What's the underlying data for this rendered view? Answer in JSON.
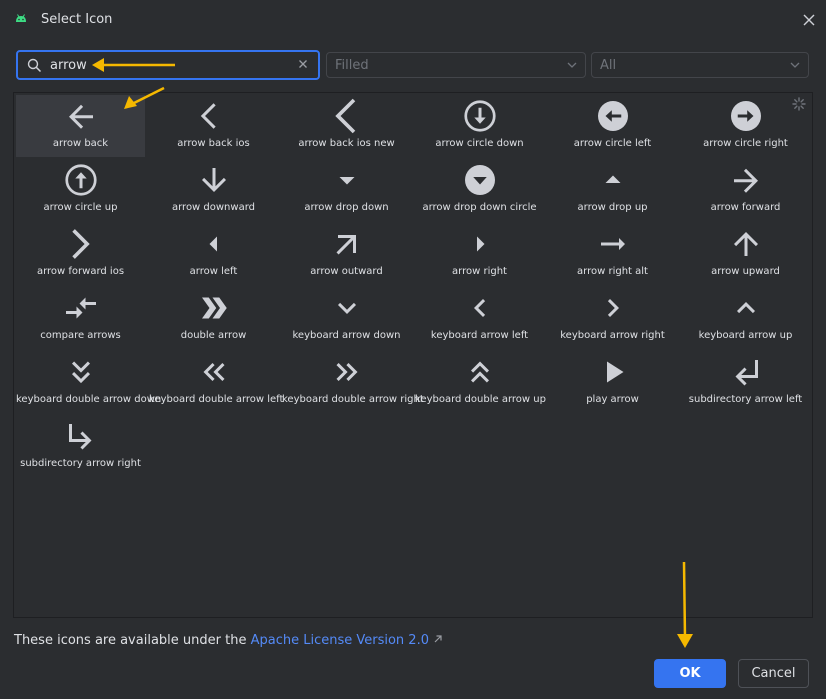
{
  "dialog": {
    "title": "Select Icon",
    "app_icon": "android-icon",
    "close_icon": "close-icon"
  },
  "search": {
    "value": "arrow",
    "search_icon": "search-icon",
    "clear_icon": "clear-icon"
  },
  "filters": {
    "style": "Filled",
    "category": "All"
  },
  "icons": [
    {
      "label": "arrow back",
      "icon": "arrow-back",
      "selected": true
    },
    {
      "label": "arrow back ios",
      "icon": "arrow-back-ios"
    },
    {
      "label": "arrow back ios new",
      "icon": "arrow-back-ios-new"
    },
    {
      "label": "arrow circle down",
      "icon": "arrow-circle-down"
    },
    {
      "label": "arrow circle left",
      "icon": "arrow-circle-left"
    },
    {
      "label": "arrow circle right",
      "icon": "arrow-circle-right"
    },
    {
      "label": "arrow circle up",
      "icon": "arrow-circle-up"
    },
    {
      "label": "arrow downward",
      "icon": "arrow-downward"
    },
    {
      "label": "arrow drop down",
      "icon": "arrow-drop-down"
    },
    {
      "label": "arrow drop down circle",
      "icon": "arrow-drop-down-circle"
    },
    {
      "label": "arrow drop up",
      "icon": "arrow-drop-up"
    },
    {
      "label": "arrow forward",
      "icon": "arrow-forward"
    },
    {
      "label": "arrow forward ios",
      "icon": "arrow-forward-ios"
    },
    {
      "label": "arrow left",
      "icon": "arrow-left"
    },
    {
      "label": "arrow outward",
      "icon": "arrow-outward"
    },
    {
      "label": "arrow right",
      "icon": "arrow-right"
    },
    {
      "label": "arrow right alt",
      "icon": "arrow-right-alt"
    },
    {
      "label": "arrow upward",
      "icon": "arrow-upward"
    },
    {
      "label": "compare arrows",
      "icon": "compare-arrows"
    },
    {
      "label": "double arrow",
      "icon": "double-arrow"
    },
    {
      "label": "keyboard arrow down",
      "icon": "keyboard-arrow-down"
    },
    {
      "label": "keyboard arrow left",
      "icon": "keyboard-arrow-left"
    },
    {
      "label": "keyboard arrow right",
      "icon": "keyboard-arrow-right"
    },
    {
      "label": "keyboard arrow up",
      "icon": "keyboard-arrow-up"
    },
    {
      "label": "keyboard double arrow down",
      "icon": "keyboard-double-arrow-down"
    },
    {
      "label": "keyboard double arrow left",
      "icon": "keyboard-double-arrow-left"
    },
    {
      "label": "keyboard double arrow right",
      "icon": "keyboard-double-arrow-right"
    },
    {
      "label": "keyboard double arrow up",
      "icon": "keyboard-double-arrow-up"
    },
    {
      "label": "play arrow",
      "icon": "play-arrow"
    },
    {
      "label": "subdirectory arrow left",
      "icon": "subdirectory-arrow-left"
    },
    {
      "label": "subdirectory arrow right",
      "icon": "subdirectory-arrow-right"
    }
  ],
  "license": {
    "text": "These icons are available under the",
    "link": "Apache License Version 2.0"
  },
  "buttons": {
    "ok": "OK",
    "cancel": "Cancel"
  },
  "colors": {
    "background": "#2b2d30",
    "accent": "#3574f0",
    "link": "#548af7",
    "annotation": "#f5b800"
  }
}
